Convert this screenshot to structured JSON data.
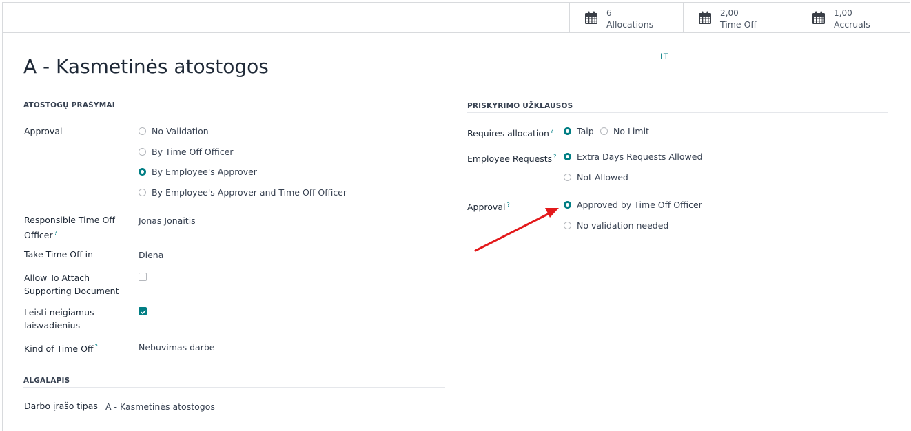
{
  "stats": [
    {
      "value": "6",
      "label": "Allocations"
    },
    {
      "value": "2,00",
      "label": "Time Off"
    },
    {
      "value": "1,00",
      "label": "Accruals"
    }
  ],
  "title": "A - Kasmetinės atostogos",
  "lang_badge": "LT",
  "left": {
    "section_title": "ATOSTOGŲ PRAŠYMAI",
    "approval_label": "Approval",
    "approval_options": [
      "No Validation",
      "By Time Off Officer",
      "By Employee's Approver",
      "By Employee's Approver and Time Off Officer"
    ],
    "approval_selected": 2,
    "responsible_label_1": "Responsible Time Off",
    "responsible_label_2": "Officer",
    "responsible_value": "Jonas Jonaitis",
    "take_time_label": "Take Time Off in",
    "take_time_value": "Diena",
    "attach_label_1": "Allow To Attach",
    "attach_label_2": "Supporting Document",
    "attach_checked": false,
    "negative_label_1": "Leisti neigiamus",
    "negative_label_2": "laisvadienius",
    "negative_checked": true,
    "kind_label": "Kind of Time Off",
    "kind_value": "Nebuvimas darbe"
  },
  "payroll": {
    "section_title": "ALGALAPIS",
    "work_entry_label": "Darbo įrašo tipas",
    "work_entry_value": "A - Kasmetinės atostogos"
  },
  "right": {
    "section_title": "PRISKYRIMO UŽKLAUSOS",
    "requires_label": "Requires allocation",
    "requires_options": [
      "Taip",
      "No Limit"
    ],
    "requires_selected": 0,
    "employee_requests_label": "Employee Requests",
    "employee_requests_options": [
      "Extra Days Requests Allowed",
      "Not Allowed"
    ],
    "employee_requests_selected": 0,
    "approval_label": "Approval",
    "approval_options": [
      "Approved by Time Off Officer",
      "No validation needed"
    ],
    "approval_selected": 0
  },
  "help_mark": "?",
  "colors": {
    "accent": "#017e84",
    "annotation_arrow": "#e3191b"
  }
}
